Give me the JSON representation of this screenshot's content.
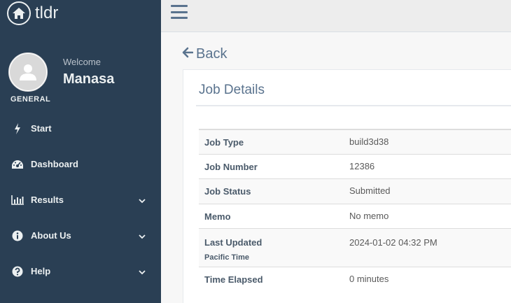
{
  "brand": {
    "name": "tldr",
    "icon": "home-icon"
  },
  "profile": {
    "welcome": "Welcome",
    "username": "Manasa"
  },
  "sidebar": {
    "section_title": "GENERAL",
    "items": [
      {
        "label": "Start",
        "icon": "bolt-icon",
        "has_submenu": false
      },
      {
        "label": "Dashboard",
        "icon": "dashboard-icon",
        "has_submenu": false
      },
      {
        "label": "Results",
        "icon": "bar-chart-icon",
        "has_submenu": true
      },
      {
        "label": "About Us",
        "icon": "info-icon",
        "has_submenu": true
      },
      {
        "label": "Help",
        "icon": "question-icon",
        "has_submenu": true
      }
    ]
  },
  "main": {
    "back_label": "Back",
    "panel_title": "Job Details",
    "rows": [
      {
        "label": "Job Type",
        "value": "build3d38"
      },
      {
        "label": "Job Number",
        "value": "12386"
      },
      {
        "label": "Job Status",
        "value": "Submitted"
      },
      {
        "label": "Memo",
        "value": "No memo"
      },
      {
        "label": "Last Updated",
        "sublabel": "Pacific Time",
        "value": "2024-01-02 04:32 PM"
      },
      {
        "label": "Time Elapsed",
        "value": "0 minutes"
      }
    ]
  },
  "colors": {
    "sidebar_bg": "#2a3f54",
    "accent": "#5a738e",
    "topbar_bg": "#ededed"
  }
}
